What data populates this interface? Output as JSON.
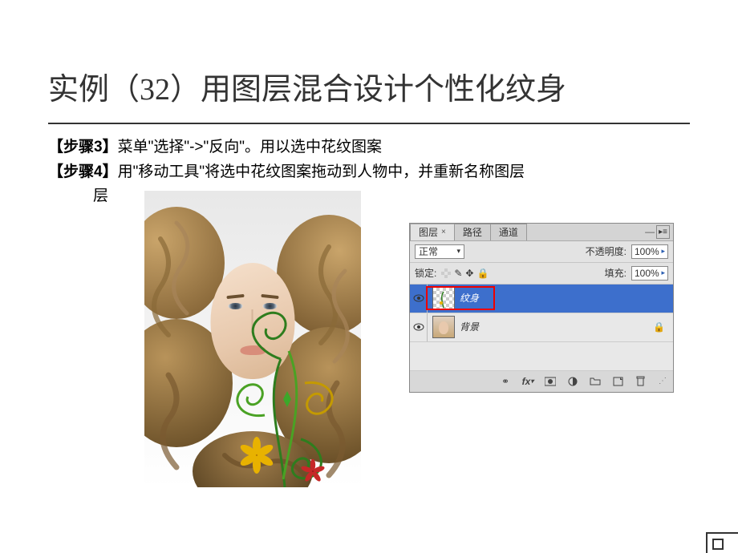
{
  "slide": {
    "title": "实例（32）用图层混合设计个性化纹身",
    "steps": [
      {
        "label": "【步骤3】",
        "text": "菜单\"选择\"->\"反向\"。用以选中花纹图案"
      },
      {
        "label": "【步骤4】",
        "text": "用\"移动工具\"将选中花纹图案拖动到人物中，并重新名称图层"
      }
    ],
    "step_cont_indent": "层"
  },
  "layers_panel": {
    "tabs": [
      "图层",
      "路径",
      "通道"
    ],
    "active_tab": 0,
    "blend_mode": "正常",
    "opacity_label": "不透明度:",
    "opacity_value": "100%",
    "lock_label": "锁定:",
    "fill_label": "填充:",
    "fill_value": "100%",
    "layers": [
      {
        "name": "纹身",
        "selected": true,
        "highlighted": true,
        "thumb": "checker",
        "locked": false
      },
      {
        "name": "背景",
        "selected": false,
        "thumb": "portrait",
        "locked": true
      }
    ],
    "footer_icons": [
      "link",
      "fx",
      "mask",
      "adjust",
      "folder",
      "new",
      "trash"
    ]
  }
}
